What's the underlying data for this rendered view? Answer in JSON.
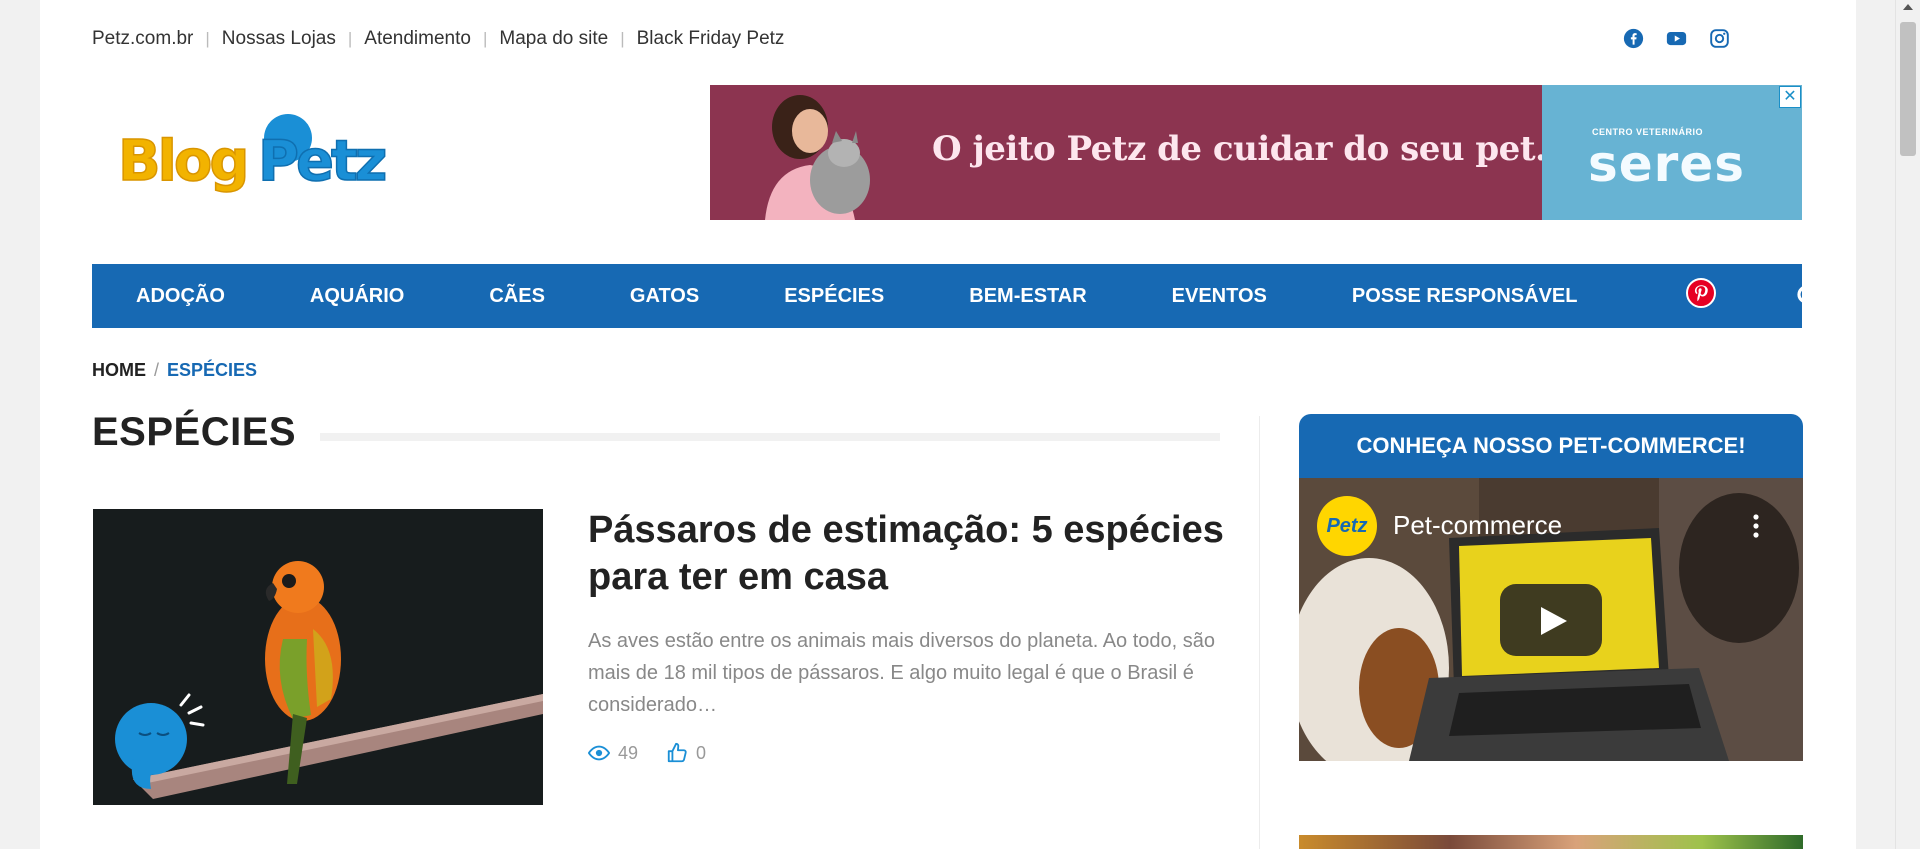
{
  "top_links": [
    "Petz.com.br",
    "Nossas Lojas",
    "Atendimento",
    "Mapa do site",
    "Black Friday Petz"
  ],
  "social": [
    "facebook-icon",
    "youtube-icon",
    "instagram-icon"
  ],
  "logo": {
    "text": "BlogPetz"
  },
  "banner": {
    "slogan": "O jeito Petz  de cuidar do seu pet.",
    "seres_small": "CENTRO VETERINÁRIO",
    "seres_big": "seres",
    "close": "✕"
  },
  "nav": {
    "items": [
      "ADOÇÃO",
      "AQUÁRIO",
      "CÃES",
      "GATOS",
      "ESPÉCIES",
      "BEM-ESTAR",
      "EVENTOS",
      "POSSE RESPONSÁVEL"
    ]
  },
  "breadcrumb": {
    "home": "HOME",
    "sep": "/",
    "current": "ESPÉCIES"
  },
  "section_title": "ESPÉCIES",
  "article": {
    "title": "Pássaros de estimação: 5 espécies para ter em casa",
    "excerpt": "As aves estão entre os animais mais diversos do planeta. Ao todo, são mais de 18 mil tipos de pássaros. E algo muito legal é que o Brasil é considerado…",
    "views": "49",
    "likes": "0"
  },
  "sidebar": {
    "widget_title": "CONHEÇA NOSSO PET-COMMERCE!",
    "video": {
      "channel_label": "Petz",
      "title": "Pet-commerce"
    }
  },
  "colors": {
    "brand_blue": "#1769b3",
    "banner_maroon": "#8c3450",
    "seres_blue": "#67b3d3"
  }
}
